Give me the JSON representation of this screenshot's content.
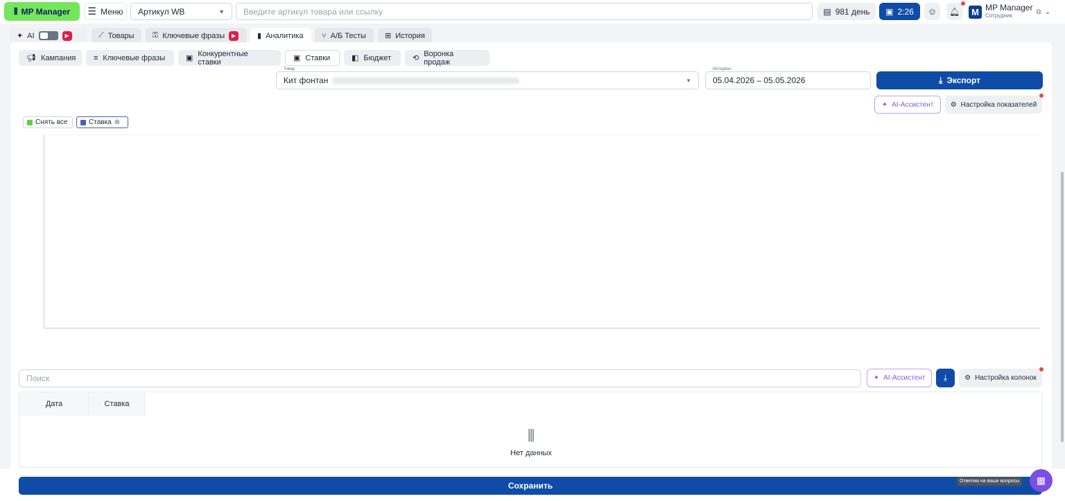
{
  "header": {
    "logo_text": "MP Manager",
    "menu_label": "Меню",
    "article_select": "Артикул WB",
    "search_placeholder": "Введите артикул товара или ссылку",
    "days_label": "981 день",
    "timer_label": "2:26",
    "user_name": "MP Manager",
    "user_role": "Сотрудник",
    "avatar_letter": "M"
  },
  "tabs": [
    {
      "label": "AI"
    },
    {
      "label": "Товары"
    },
    {
      "label": "Ключевые фразы"
    },
    {
      "label": "Аналитика"
    },
    {
      "label": "А/Б Тесты"
    },
    {
      "label": "История"
    }
  ],
  "subtabs": [
    {
      "label": "Кампания"
    },
    {
      "label": "Ключевые фразы"
    },
    {
      "label": "Конкурентные ставки"
    },
    {
      "label": "Ставки"
    },
    {
      "label": "Бюджет"
    },
    {
      "label": "Воронка продаж"
    }
  ],
  "filters": {
    "product_label": "Товар",
    "product_value": "Кит фонтан",
    "interval_label": "Интервал",
    "interval_value": "05.04.2026 – 05.05.2026",
    "export_label": "Экспорт",
    "ai_assistant_label": "AI-Ассистент",
    "metrics_settings_label": "Настройка показателей"
  },
  "legend": {
    "deselect_all": "Снять все",
    "series_name": "Ставка",
    "deselect_color": "#5bd43c",
    "series_color": "#4b5fb0"
  },
  "table": {
    "search_placeholder": "Поиск",
    "ai_assistant_label": "AI-Ассистент",
    "columns_settings_label": "Настройка колонок",
    "columns": [
      "Дата",
      "Ставка"
    ],
    "empty_text": "Нет данных"
  },
  "footer": {
    "save_label": "Сохранить",
    "chat_tooltip": "Ответим на ваши вопросы"
  },
  "colors": {
    "primary": "#0f4ca8",
    "brand_green": "#74e65c",
    "ai_purple": "#7c5bd6"
  }
}
